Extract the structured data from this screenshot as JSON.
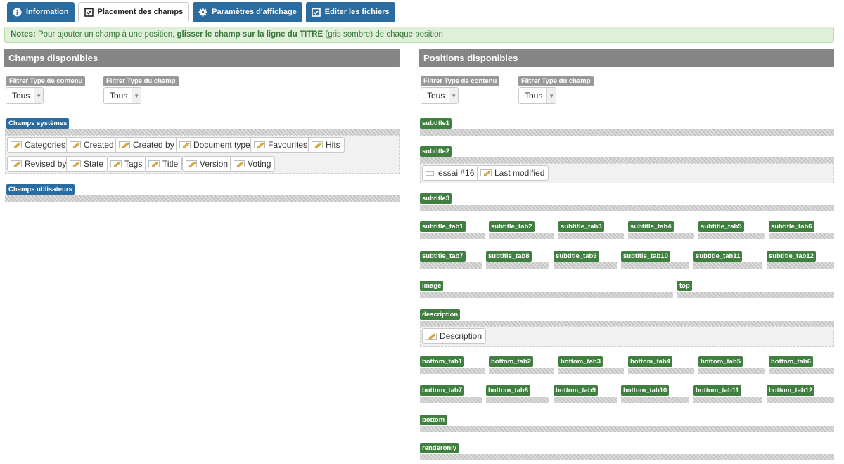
{
  "tabs": [
    {
      "label": "Information",
      "icon": "info-icon",
      "active": false
    },
    {
      "label": "Placement des champs",
      "icon": "checklist-icon",
      "active": true
    },
    {
      "label": "Paramètres d'affichage",
      "icon": "gear-icon",
      "active": false
    },
    {
      "label": "Editer les fichiers",
      "icon": "checklist-icon",
      "active": false
    }
  ],
  "notes": {
    "prefix": "Notes:",
    "text1": " Pour ajouter un champ à une position, ",
    "bold": "glisser le champ sur la ligne du TITRE",
    "text2": " (gris sombre) de chaque position"
  },
  "left": {
    "header": "Champs disponibles",
    "filter_type_label": "Filtrer Type de contenu",
    "filter_type_value": "Tous",
    "filter_field_label": "Filtrer Type du champ",
    "filter_field_value": "Tous",
    "system_label": "Champs systèmes",
    "system_fields": [
      "Categories",
      "Created",
      "Created by",
      "Document type",
      "Favourites",
      "Hits",
      "Revised by",
      "State",
      "Tags",
      "Title",
      "Version",
      "Voting"
    ],
    "user_label": "Champs utilisateurs"
  },
  "right": {
    "header": "Positions disponibles",
    "filter_type_label": "Filtrer Type de contenu",
    "filter_type_value": "Tous",
    "filter_field_label": "Filtrer Type du champ",
    "filter_field_value": "Tous",
    "positions": {
      "subtitle1": "subtitle1",
      "subtitle2": "subtitle2",
      "subtitle2_fields": [
        "essai #16",
        "Last modified"
      ],
      "subtitle3": "subtitle3",
      "subtitle_tabs_row1": [
        "subtitle_tab1",
        "subtitle_tab2",
        "subtitle_tab3",
        "subtitle_tab4",
        "subtitle_tab5",
        "subtitle_tab6"
      ],
      "subtitle_tabs_row2": [
        "subtitle_tab7",
        "subtitle_tab8",
        "subtitle_tab9",
        "subtitle_tab10",
        "subtitle_tab11",
        "subtitle_tab12"
      ],
      "image": "image",
      "top": "top",
      "description": "description",
      "description_fields": [
        "Description"
      ],
      "bottom_tabs_row1": [
        "bottom_tab1",
        "bottom_tab2",
        "bottom_tab3",
        "bottom_tab4",
        "bottom_tab5",
        "bottom_tab6"
      ],
      "bottom_tabs_row2": [
        "bottom_tab7",
        "bottom_tab8",
        "bottom_tab9",
        "bottom_tab10",
        "bottom_tab11",
        "bottom_tab12"
      ],
      "bottom": "bottom",
      "renderonly": "renderonly"
    }
  },
  "colors": {
    "tab_blue": "#2a6ca0",
    "position_green": "#3f7f3f",
    "header_gray": "#858585",
    "notes_bg": "#dff0d8"
  }
}
